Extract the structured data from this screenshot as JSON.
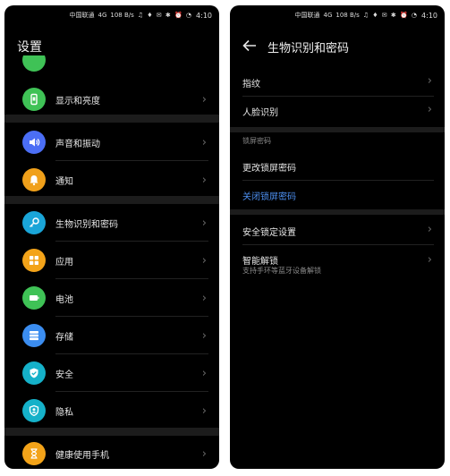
{
  "colors": {
    "display": "#3fc256",
    "sound": "#4b6ef5",
    "notify": "#f0a01a",
    "bio": "#1aa5d8",
    "apps": "#f3a319",
    "battery": "#3fc256",
    "storage": "#3b8df0",
    "security": "#15b1c9",
    "privacy": "#15b1c9",
    "wellbeing": "#f3a319",
    "accent": "#4d8ff0"
  },
  "status_bar": {
    "carrier": "中国联通",
    "network": "4G",
    "speed": "108 B/s",
    "time": "4:10"
  },
  "left": {
    "title": "设置",
    "items": [
      {
        "label": "显示和亮度",
        "icon": "display-icon"
      },
      {
        "label": "声音和振动",
        "icon": "sound-icon"
      },
      {
        "label": "通知",
        "icon": "bell-icon"
      },
      {
        "label": "生物识别和密码",
        "icon": "key-icon"
      },
      {
        "label": "应用",
        "icon": "apps-icon"
      },
      {
        "label": "电池",
        "icon": "battery-icon"
      },
      {
        "label": "存储",
        "icon": "storage-icon"
      },
      {
        "label": "安全",
        "icon": "shield-icon"
      },
      {
        "label": "隐私",
        "icon": "privacy-icon"
      },
      {
        "label": "健康使用手机",
        "icon": "hourglass-icon"
      }
    ]
  },
  "right": {
    "title": "生物识别和密码",
    "fingerprint": "指纹",
    "face": "人脸识别",
    "section_lock": "锁屏密码",
    "change_password": "更改锁屏密码",
    "disable_password": "关闭锁屏密码",
    "security_lock": "安全锁定设置",
    "smart_unlock": "智能解锁",
    "smart_unlock_sub": "支持手环等蓝牙设备解锁"
  }
}
